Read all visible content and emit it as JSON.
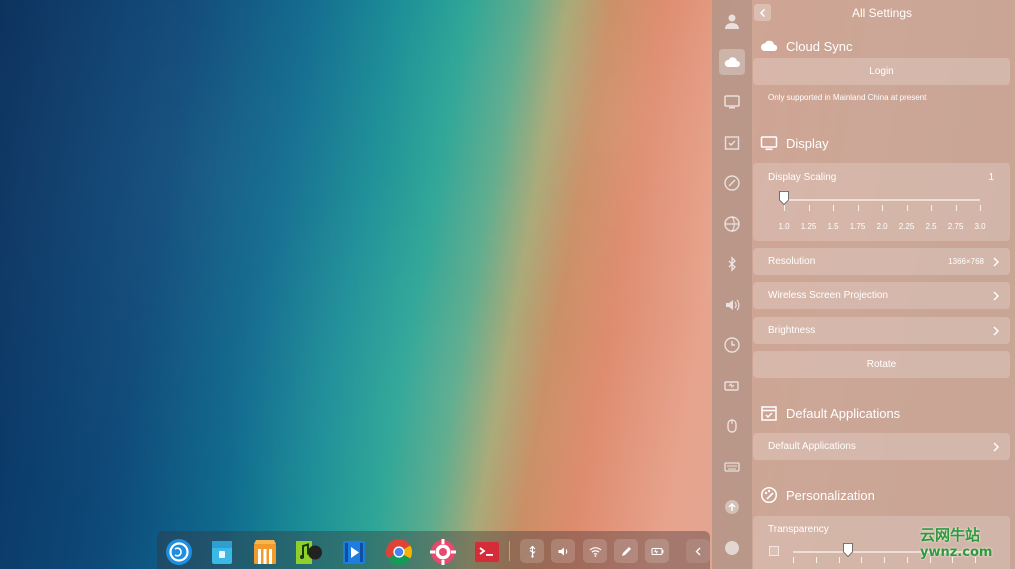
{
  "settings": {
    "title": "All Settings",
    "cloud_sync": {
      "title": "Cloud Sync",
      "login_label": "Login",
      "note": "Only supported in Mainland China at present"
    },
    "display": {
      "title": "Display",
      "scaling_label": "Display Scaling",
      "scaling_value": "1",
      "scaling_ticks": [
        "1.0",
        "1.25",
        "1.5",
        "1.75",
        "2.0",
        "2.25",
        "2.5",
        "2.75",
        "3.0"
      ],
      "scaling_selected_index": 0,
      "resolution_label": "Resolution",
      "resolution_value": "1366×768",
      "projection_label": "Wireless Screen Projection",
      "brightness_label": "Brightness",
      "rotate_label": "Rotate"
    },
    "default_apps": {
      "title": "Default Applications",
      "row_label": "Default Applications"
    },
    "personalization": {
      "title": "Personalization",
      "transparency_label": "Transparency",
      "transparency_fraction": 0.3
    },
    "nav_icons": [
      "account-icon",
      "cloud-icon",
      "display-icon",
      "default-apps-icon",
      "personalization-icon",
      "network-icon",
      "bluetooth-icon",
      "sound-icon",
      "datetime-icon",
      "power-icon",
      "mouse-icon",
      "keyboard-icon",
      "update-icon",
      "system-info-icon"
    ]
  },
  "dock": {
    "apps": [
      "launcher-icon",
      "file-manager-icon",
      "app-store-icon",
      "music-icon",
      "movie-icon",
      "chrome-icon",
      "settings-icon",
      "terminal-icon"
    ],
    "tray": [
      "usb-icon",
      "volume-icon",
      "wifi-icon",
      "pen-icon",
      "battery-icon",
      "collapse-arrow-icon"
    ]
  },
  "watermark": {
    "line1": "云网牛站",
    "line2": "ywnz.com"
  },
  "colors": {
    "panel_bg": "#c8a596",
    "watermark": "#2e9a3a"
  }
}
